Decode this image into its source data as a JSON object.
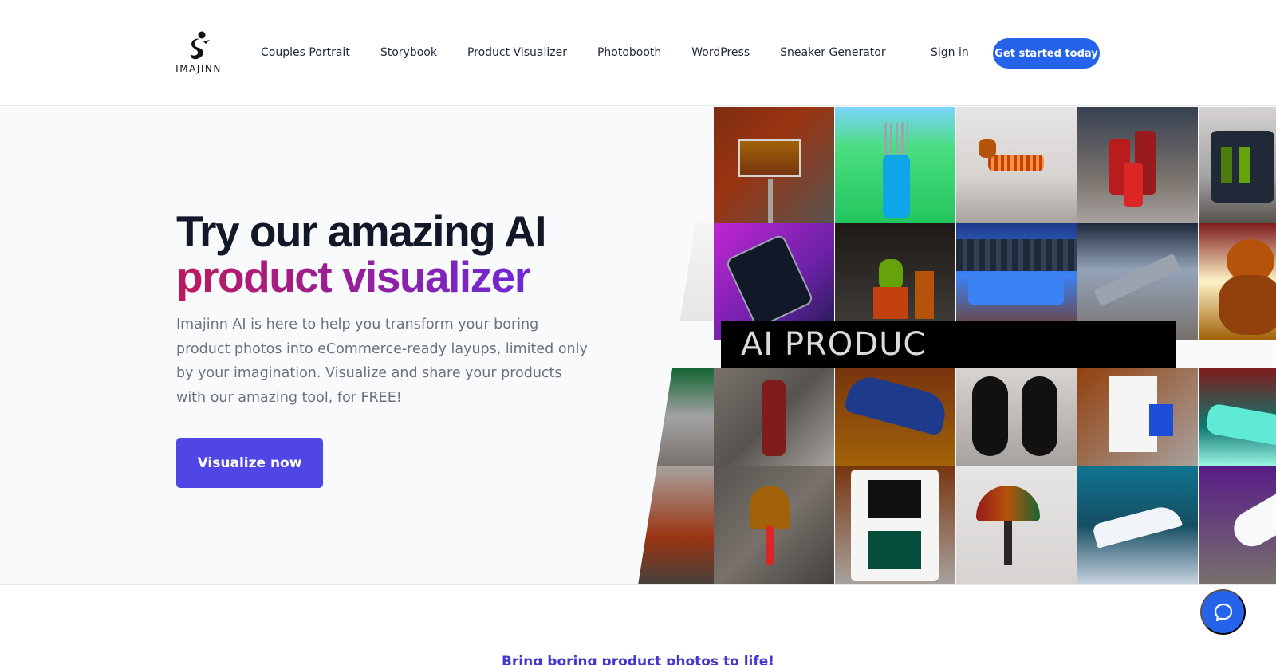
{
  "header": {
    "logo_text": "IMAJINN",
    "nav": [
      "Couples Portrait",
      "Storybook",
      "Product Visualizer",
      "Photobooth",
      "WordPress",
      "Sneaker Generator"
    ],
    "signin_label": "Sign in",
    "cta_label": "Get started today"
  },
  "hero": {
    "title_line1": "Try our amazing AI",
    "title_line2": "product visualizer",
    "lead": "Imajinn AI is here to help you transform your boring product photos into eCommerce-ready layups, limited only by your imagination. Visualize and share your products with our amazing tool, for FREE!",
    "button_label": "Visualize now",
    "banner_text": "AI PRODUC"
  },
  "collage": {
    "tiles": [
      {
        "name": "painting-on-brick-tile"
      },
      {
        "name": "golf-bag-tile"
      },
      {
        "name": "slinky-dog-tile"
      },
      {
        "name": "red-candles-tile"
      },
      {
        "name": "lotion-bottles-tile"
      },
      {
        "name": "smartphone-tile"
      },
      {
        "name": "cactus-bottle-tile"
      },
      {
        "name": "classic-car-city-tile"
      },
      {
        "name": "toy-ship-tile"
      },
      {
        "name": "teddy-bear-tile"
      },
      {
        "name": "figurine-tile"
      },
      {
        "name": "blue-sneaker-tile"
      },
      {
        "name": "black-sneakers-tile"
      },
      {
        "name": "appliance-tile"
      },
      {
        "name": "vintage-car-tile"
      },
      {
        "name": "bell-tile"
      },
      {
        "name": "handheld-console-tile"
      },
      {
        "name": "tiffany-lamp-tile"
      },
      {
        "name": "speedboat-tile"
      },
      {
        "name": "white-sneaker-tile"
      }
    ]
  },
  "below": {
    "section_title": "Bring boring product photos to life!"
  },
  "colors": {
    "primary": "#2563eb",
    "hero_button": "#4f46e5",
    "gradient_start": "#be185d",
    "gradient_end": "#6d28d9",
    "section_title": "#4338ca"
  },
  "icons": {
    "chat": "chat-bubble-icon",
    "logo": "imajinn-logo-icon"
  }
}
